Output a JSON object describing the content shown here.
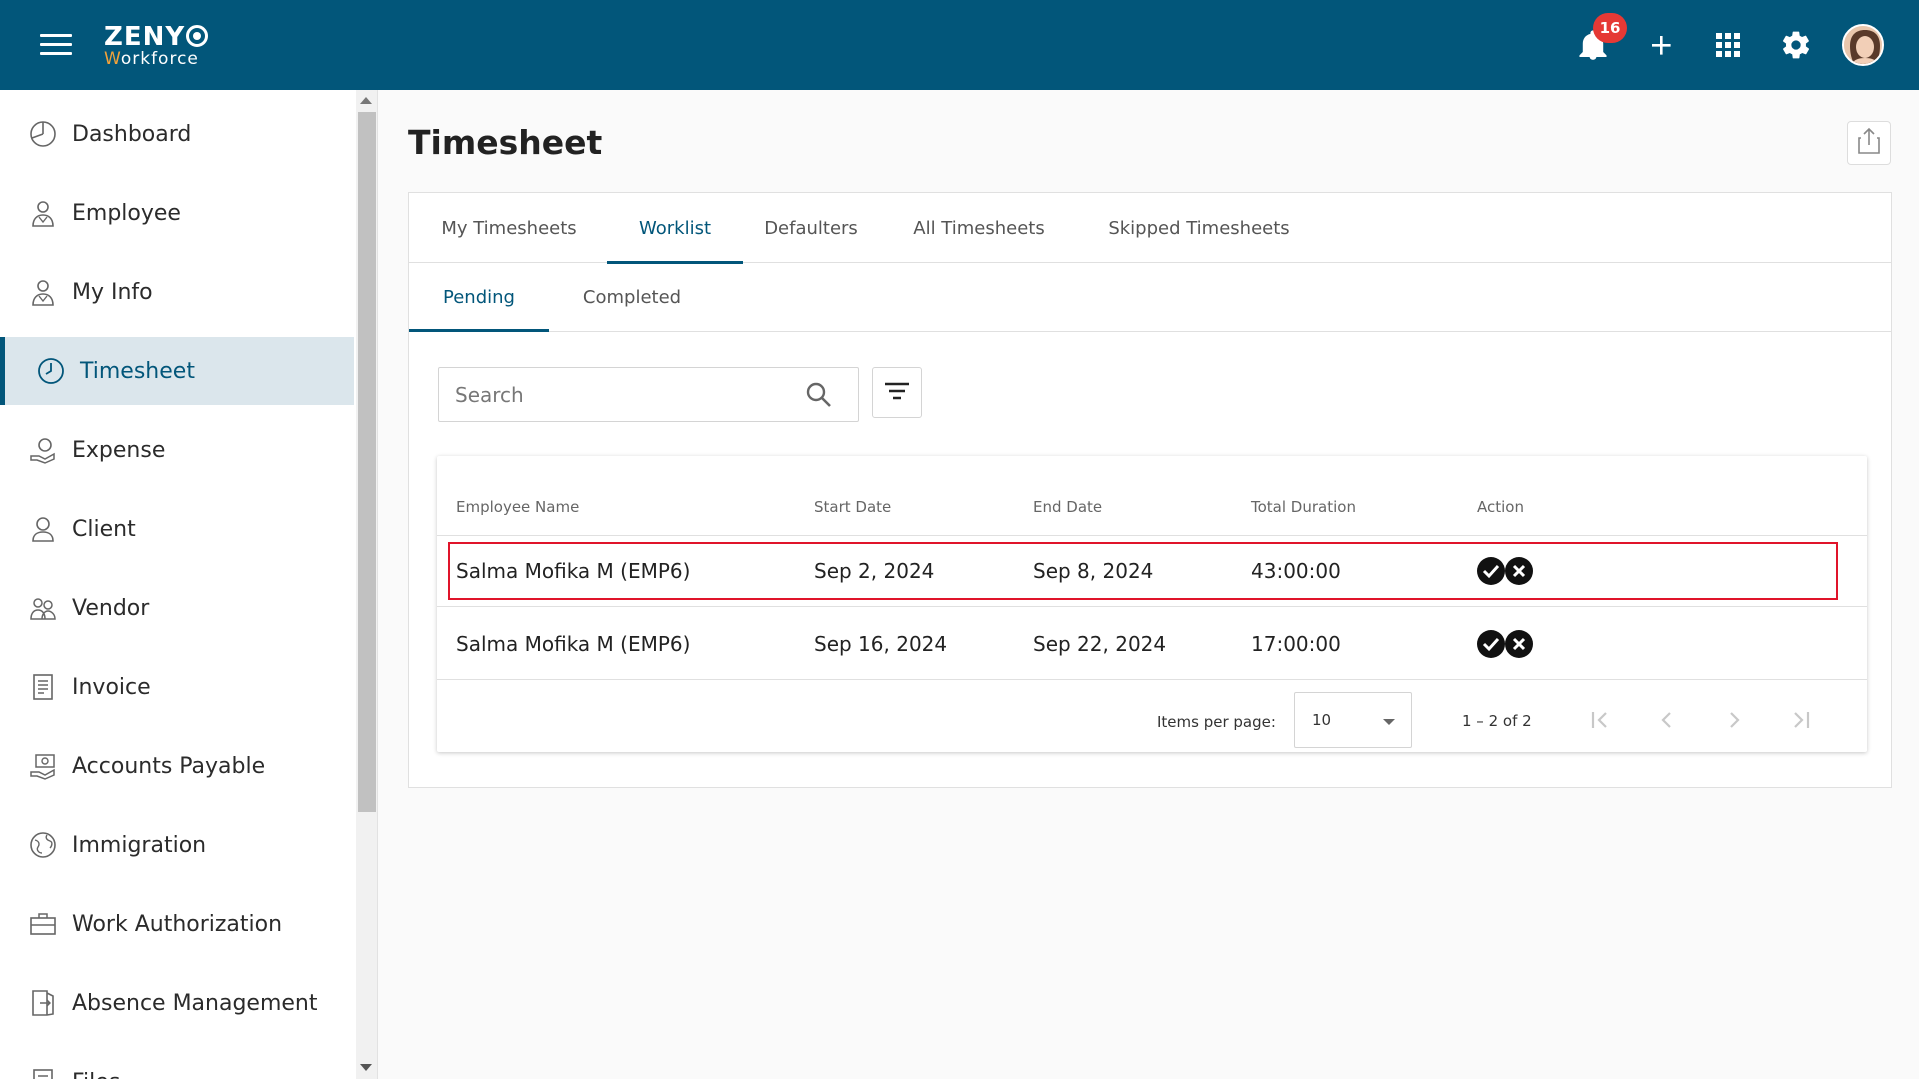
{
  "app": {
    "logo_line1": "ZENY",
    "logo_line2_prefix": "W",
    "logo_line2_rest": "orkforce",
    "notification_count": "16"
  },
  "sidebar": {
    "items": [
      {
        "label": "Dashboard",
        "icon": "dashboard-icon"
      },
      {
        "label": "Employee",
        "icon": "employee-icon"
      },
      {
        "label": "My Info",
        "icon": "my-info-icon"
      },
      {
        "label": "Timesheet",
        "icon": "clock-icon"
      },
      {
        "label": "Expense",
        "icon": "expense-icon"
      },
      {
        "label": "Client",
        "icon": "client-icon"
      },
      {
        "label": "Vendor",
        "icon": "vendor-icon"
      },
      {
        "label": "Invoice",
        "icon": "invoice-icon"
      },
      {
        "label": "Accounts Payable",
        "icon": "accounts-payable-icon"
      },
      {
        "label": "Immigration",
        "icon": "globe-icon"
      },
      {
        "label": "Work Authorization",
        "icon": "briefcase-icon"
      },
      {
        "label": "Absence Management",
        "icon": "door-icon"
      },
      {
        "label": "Files",
        "icon": "files-icon"
      }
    ]
  },
  "page": {
    "title": "Timesheet"
  },
  "tabs": [
    "My Timesheets",
    "Worklist",
    "Defaulters",
    "All Timesheets",
    "Skipped Timesheets"
  ],
  "active_tab": "Worklist",
  "subtabs": [
    "Pending",
    "Completed"
  ],
  "active_subtab": "Pending",
  "search": {
    "placeholder": "Search",
    "value": ""
  },
  "table": {
    "columns": [
      "Employee Name",
      "Start Date",
      "End Date",
      "Total Duration",
      "Action"
    ],
    "rows": [
      {
        "employee": "Salma Mofika M (EMP6)",
        "start": "Sep 2, 2024",
        "end": "Sep 8, 2024",
        "duration": "43:00:00"
      },
      {
        "employee": "Salma Mofika M (EMP6)",
        "start": "Sep 16, 2024",
        "end": "Sep 22, 2024",
        "duration": "17:00:00"
      }
    ]
  },
  "paginator": {
    "label": "Items per page:",
    "page_size": "10",
    "range": "1 – 2 of 2"
  },
  "colors": {
    "brand": "#02567a",
    "badge": "#e53935",
    "highlight": "#e0142a",
    "active_bg": "#dbe6ec"
  }
}
